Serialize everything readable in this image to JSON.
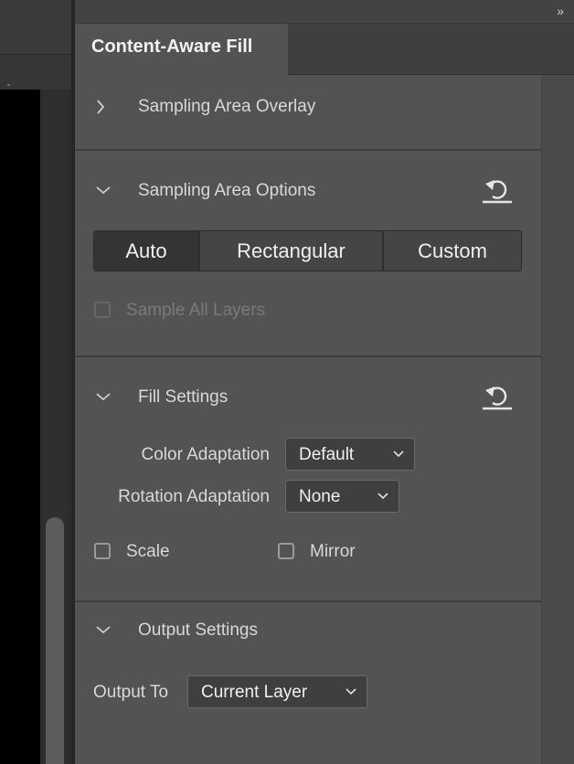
{
  "panel": {
    "tab_label": "Content-Aware Fill",
    "collapse_glyph": "»"
  },
  "sections": {
    "sampling_overlay": {
      "title": "Sampling Area Overlay",
      "expanded": false
    },
    "sampling_options": {
      "title": "Sampling Area Options",
      "expanded": true,
      "modes": [
        "Auto",
        "Rectangular",
        "Custom"
      ],
      "selected_mode": "Auto",
      "sample_all_layers_label": "Sample All Layers",
      "sample_all_layers_checked": false,
      "sample_all_layers_enabled": false
    },
    "fill_settings": {
      "title": "Fill Settings",
      "expanded": true,
      "color_adaptation_label": "Color Adaptation",
      "color_adaptation_value": "Default",
      "rotation_adaptation_label": "Rotation Adaptation",
      "rotation_adaptation_value": "None",
      "scale_label": "Scale",
      "scale_checked": false,
      "mirror_label": "Mirror",
      "mirror_checked": false
    },
    "output_settings": {
      "title": "Output Settings",
      "expanded": true,
      "output_to_label": "Output To",
      "output_to_value": "Current Layer"
    }
  },
  "icons": {
    "collapse": "double-chevron-right-icon",
    "chevron_collapsed": "chevron-right-icon",
    "chevron_expanded": "chevron-down-icon",
    "reset": "reset-icon",
    "dropdown": "chevron-down-icon"
  },
  "colors": {
    "panel_bg": "#535353",
    "header_bg": "#434343",
    "text": "#d8d8d8",
    "active_segment": "#343434",
    "canvas": "#000000"
  }
}
